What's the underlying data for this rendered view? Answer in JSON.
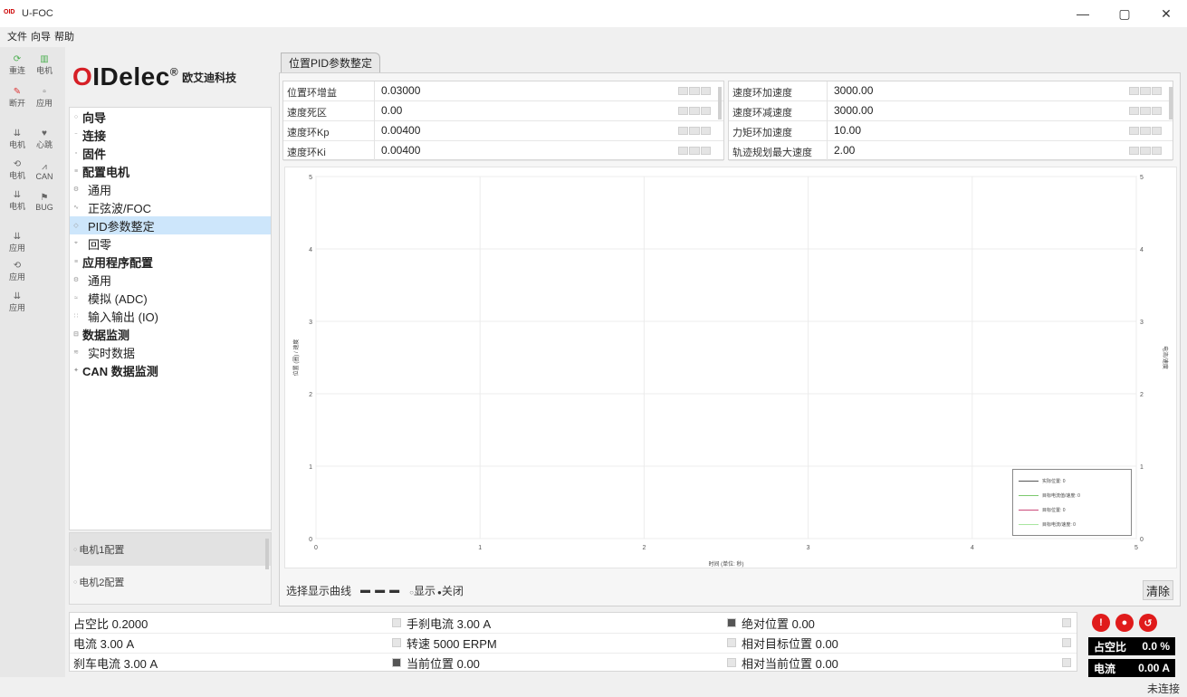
{
  "window": {
    "title": "U-FOC",
    "logo_text": "OID",
    "minimize": "—",
    "restore": "▢",
    "close": "✕"
  },
  "menu": [
    "文件",
    "向导",
    "帮助"
  ],
  "toolbar": [
    {
      "label": "重连",
      "icon": "⟳"
    },
    {
      "label": "电机",
      "icon": "▥"
    },
    {
      "label": "断开",
      "icon": "✎"
    },
    {
      "label": "应用",
      "icon": "▫"
    },
    {
      "label": "电机",
      "icon": "⇊"
    },
    {
      "label": "心跳",
      "icon": "♥"
    },
    {
      "label": "电机",
      "icon": "⟲"
    },
    {
      "label": "CAN",
      "icon": "⩘"
    },
    {
      "label": "电机",
      "icon": "⇊"
    },
    {
      "label": "BUG",
      "icon": "⚑"
    },
    {
      "label": "应用",
      "icon": "⇊"
    },
    {
      "label": "应用",
      "icon": "⟲"
    },
    {
      "label": "应用",
      "icon": "⇊"
    }
  ],
  "brand": {
    "name_o": "O",
    "name_rest": "IDelec",
    "reg": "®",
    "cn": "欧艾迪科技"
  },
  "nav": [
    {
      "label": "向导",
      "level": 1,
      "bullet": "○"
    },
    {
      "label": "连接",
      "level": 1,
      "bullet": "⁻"
    },
    {
      "label": "固件",
      "level": 1,
      "bullet": "▫"
    },
    {
      "label": "配置电机",
      "level": 1,
      "bullet": "≡"
    },
    {
      "label": "通用",
      "level": 2,
      "bullet": "⚙"
    },
    {
      "label": "正弦波/FOC",
      "level": 2,
      "bullet": "∿"
    },
    {
      "label": "PID参数整定",
      "level": 2,
      "bullet": "◇",
      "selected": true
    },
    {
      "label": "回零",
      "level": 2,
      "bullet": "⌖"
    },
    {
      "label": "应用程序配置",
      "level": 1,
      "bullet": "≡"
    },
    {
      "label": "通用",
      "level": 2,
      "bullet": "⚙"
    },
    {
      "label": "模拟 (ADC)",
      "level": 2,
      "bullet": "≈"
    },
    {
      "label": "输入输出 (IO)",
      "level": 2,
      "bullet": "∷"
    },
    {
      "label": "数据监测",
      "level": 1,
      "bullet": "⊟"
    },
    {
      "label": "实时数据",
      "level": 2,
      "bullet": "≋"
    },
    {
      "label": "CAN 数据监测",
      "level": 1,
      "bullet": "✦"
    }
  ],
  "motor_configs": [
    {
      "label": "电机1配置",
      "bullet": "○"
    },
    {
      "label": "电机2配置",
      "bullet": "○"
    }
  ],
  "tab": "位置PID参数整定",
  "params_left": [
    {
      "label": "位置环增益",
      "value": "0.03000"
    },
    {
      "label": "速度死区",
      "value": "0.00"
    },
    {
      "label": "速度环Kp",
      "value": "0.00400"
    },
    {
      "label": "速度环Ki",
      "value": "0.00400"
    }
  ],
  "params_right": [
    {
      "label": "速度环加速度",
      "value": "3000.00"
    },
    {
      "label": "速度环减速度",
      "value": "3000.00"
    },
    {
      "label": "力矩环加速度",
      "value": "10.00"
    },
    {
      "label": "轨迹规划最大速度",
      "value": "2.00"
    }
  ],
  "chart_data": {
    "type": "line",
    "x_ticks": [
      "0",
      "1",
      "2",
      "3",
      "4",
      "5"
    ],
    "y_ticks": [
      "0",
      "1",
      "2",
      "3",
      "4",
      "5"
    ],
    "y2_ticks": [
      "0",
      "1",
      "2",
      "3",
      "4",
      "5"
    ],
    "xlim": [
      0,
      5
    ],
    "ylim": [
      0,
      5
    ],
    "xlabel": "时间 (单位: 秒)",
    "ylabel": "位置 (圈) / 速度",
    "y2label": "电流/速度",
    "grid": true,
    "legend_position": "bottom-right",
    "series": [
      {
        "name": "实际位置: 0",
        "color": "#555555",
        "values": []
      },
      {
        "name": "目标电流值/速度: 0",
        "color": "#7cc96e",
        "values": []
      },
      {
        "name": "目标位置: 0",
        "color": "#cc4a7a",
        "values": []
      },
      {
        "name": "目标电流/速度: 0",
        "color": "#a8e6a0",
        "values": []
      }
    ]
  },
  "chart_ctrls": {
    "label": "选择显示曲线",
    "dash": "▬ ▬ ▬",
    "show": "显示",
    "hide": "关闭",
    "show_marker": "○",
    "hide_marker": "●",
    "clear": "清除"
  },
  "status": {
    "col1": [
      "占空比 0.2000",
      "电流 3.00 A",
      "刹车电流 3.00 A"
    ],
    "col2": [
      "手刹电流 3.00 A",
      "转速 5000 ERPM",
      "当前位置 0.00"
    ],
    "col3": [
      "绝对位置 0.00",
      "相对目标位置 0.00",
      "相对当前位置 0.00"
    ]
  },
  "right_panel": {
    "buttons": [
      {
        "icon": "!",
        "color": "#e01b1b"
      },
      {
        "icon": "●",
        "color": "#e01b1b"
      },
      {
        "icon": "↺",
        "color": "#e01b1b"
      }
    ],
    "duty_label": "占空比",
    "duty_value": "0.0 %",
    "current_label": "电流",
    "current_value": "0.00 A"
  },
  "statusbar": {
    "connection": "未连接"
  }
}
